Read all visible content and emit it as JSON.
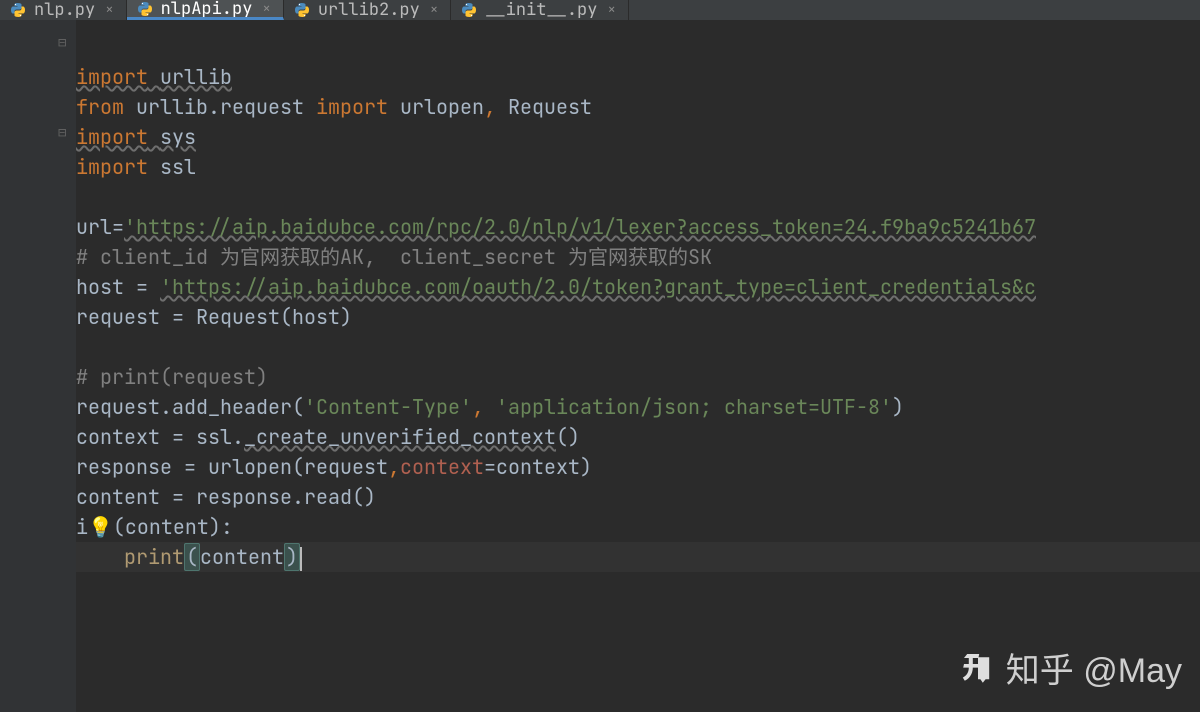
{
  "tabs": [
    {
      "name": "nlp.py",
      "active": false
    },
    {
      "name": "nlpApi.py",
      "active": true
    },
    {
      "name": "urllib2.py",
      "active": false
    },
    {
      "name": "__init__.py",
      "active": false
    }
  ],
  "code": {
    "l1": {
      "kw": "import",
      "mod": "urllib"
    },
    "l2": {
      "kw1": "from",
      "pkg": "urllib.request",
      "kw2": "import",
      "names": "urlopen",
      "comma": ",",
      "names2": " Request"
    },
    "l3": {
      "kw": "import",
      "mod": "sys"
    },
    "l4": {
      "kw": "import",
      "mod": "ssl"
    },
    "l6": {
      "lhs": "url=",
      "str": "'https://aip.baidubce.com/rpc/2.0/nlp/v1/lexer?access_token=24.f9ba9c5241b67"
    },
    "l7": {
      "cmt": "# client_id 为官网获取的AK,  client_secret 为官网获取的SK"
    },
    "l8": {
      "lhs": "host = ",
      "str": "'https://aip.baidubce.com/oauth/2.0/token?grant_type=client_credentials&c"
    },
    "l9": {
      "text": "request = Request(host)"
    },
    "l11": {
      "cmt": "# print(request)"
    },
    "l12": {
      "a": "request.add_header(",
      "s1": "'Content-Type'",
      "c": ",",
      "sp": " ",
      "s2": "'application/json; charset=UTF-8'",
      "b": ")"
    },
    "l13": {
      "a": "context = ssl.",
      "fn": "_create_unverified_context",
      "b": "()"
    },
    "l14": {
      "a": "response = urlopen(request",
      "c": ",",
      "kw": "context",
      "b": "=context)"
    },
    "l15": {
      "a": "content = response.read()"
    },
    "l16": {
      "pre": "i",
      "post": "(content):"
    },
    "l17": {
      "indent": "    ",
      "fn": "print",
      "lp": "(",
      "arg": "content",
      "rp": ")"
    }
  },
  "watermark": "知乎 @May",
  "bulb_glyph": "💡"
}
